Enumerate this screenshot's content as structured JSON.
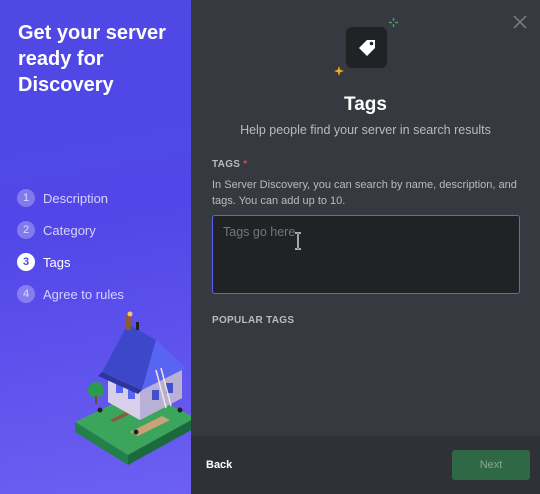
{
  "sidebar": {
    "title": "Get your server ready for Discovery",
    "steps": [
      {
        "num": "1",
        "label": "Description",
        "active": false
      },
      {
        "num": "2",
        "label": "Category",
        "active": false
      },
      {
        "num": "3",
        "label": "Tags",
        "active": true
      },
      {
        "num": "4",
        "label": "Agree to rules",
        "active": false
      }
    ]
  },
  "header": {
    "icon": "tag-icon",
    "title": "Tags",
    "subtitle": "Help people find your server in search results"
  },
  "tags_field": {
    "label": "TAGS",
    "required_marker": "*",
    "help": "In Server Discovery, you can search by name, description, and tags. You can add up to 10.",
    "placeholder": "Tags go here",
    "value": ""
  },
  "popular_tags": {
    "label": "POPULAR TAGS"
  },
  "footer": {
    "back_label": "Back",
    "next_label": "Next"
  },
  "colors": {
    "accent": "#5865f2",
    "panel_gradient": "#4f49e4",
    "next_disabled": "#2f6844",
    "required": "#ed4245"
  }
}
